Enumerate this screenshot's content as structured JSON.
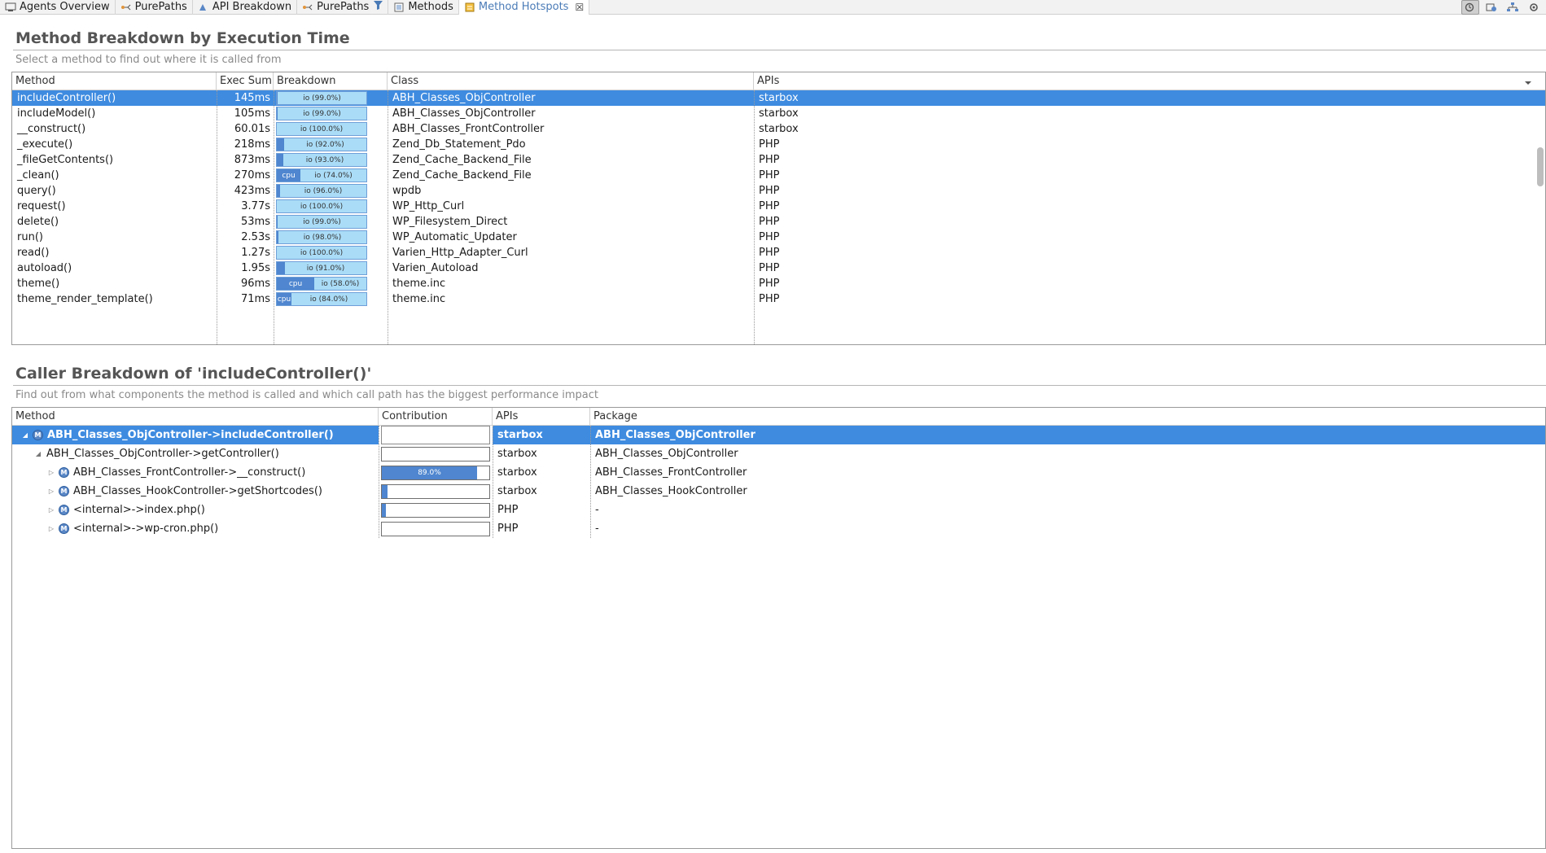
{
  "tabs": [
    {
      "label": "Agents Overview",
      "icon": "agents-icon",
      "active": false
    },
    {
      "label": "PurePaths",
      "icon": "purepaths-icon",
      "active": false
    },
    {
      "label": "API Breakdown",
      "icon": "api-breakdown-icon",
      "active": false
    },
    {
      "label": "PurePaths",
      "icon": "purepaths-filter-icon",
      "active": false
    },
    {
      "label": "Methods",
      "icon": "methods-icon",
      "active": false
    },
    {
      "label": "Method Hotspots",
      "icon": "hotspots-icon",
      "active": true,
      "closable": true
    }
  ],
  "toolbar": {
    "buttons": [
      "view-mode-icon",
      "export-icon",
      "hierarchy-icon",
      "settings-icon"
    ]
  },
  "method_breakdown": {
    "title": "Method Breakdown by Execution Time",
    "subtitle": "Select a method to find out where it is called from",
    "columns": [
      "Method",
      "Exec Sum",
      "Breakdown",
      "Class",
      "APIs"
    ],
    "rows": [
      {
        "method": "includeController()",
        "exec": "145ms",
        "cpu": 0.01,
        "io_label": "io (99.0%)",
        "class": "ABH_Classes_ObjController",
        "api": "starbox",
        "selected": true
      },
      {
        "method": "includeModel()",
        "exec": "105ms",
        "cpu": 0.01,
        "io_label": "io (99.0%)",
        "class": "ABH_Classes_ObjController",
        "api": "starbox"
      },
      {
        "method": "__construct()",
        "exec": "60.01s",
        "cpu": 0.0,
        "io_label": "io (100.0%)",
        "class": "ABH_Classes_FrontController",
        "api": "starbox"
      },
      {
        "method": "_execute()",
        "exec": "218ms",
        "cpu": 0.08,
        "io_label": "io (92.0%)",
        "class": "Zend_Db_Statement_Pdo",
        "api": "PHP"
      },
      {
        "method": "_fileGetContents()",
        "exec": "873ms",
        "cpu": 0.07,
        "io_label": "io (93.0%)",
        "class": "Zend_Cache_Backend_File",
        "api": "PHP"
      },
      {
        "method": "_clean()",
        "exec": "270ms",
        "cpu": 0.26,
        "cpu_label": "cpu",
        "io_label": "io (74.0%)",
        "class": "Zend_Cache_Backend_File",
        "api": "PHP"
      },
      {
        "method": "query()",
        "exec": "423ms",
        "cpu": 0.04,
        "io_label": "io (96.0%)",
        "class": "wpdb",
        "api": "PHP"
      },
      {
        "method": "request()",
        "exec": "3.77s",
        "cpu": 0.0,
        "io_label": "io (100.0%)",
        "class": "WP_Http_Curl",
        "api": "PHP"
      },
      {
        "method": "delete()",
        "exec": "53ms",
        "cpu": 0.01,
        "io_label": "io (99.0%)",
        "class": "WP_Filesystem_Direct",
        "api": "PHP"
      },
      {
        "method": "run()",
        "exec": "2.53s",
        "cpu": 0.02,
        "io_label": "io (98.0%)",
        "class": "WP_Automatic_Updater",
        "api": "PHP"
      },
      {
        "method": "read()",
        "exec": "1.27s",
        "cpu": 0.0,
        "io_label": "io (100.0%)",
        "class": "Varien_Http_Adapter_Curl",
        "api": "PHP"
      },
      {
        "method": "autoload()",
        "exec": "1.95s",
        "cpu": 0.09,
        "io_label": "io (91.0%)",
        "class": "Varien_Autoload",
        "api": "PHP"
      },
      {
        "method": "theme()",
        "exec": "96ms",
        "cpu": 0.42,
        "cpu_label": "cpu",
        "io_label": "io (58.0%)",
        "class": "theme.inc",
        "api": "PHP"
      },
      {
        "method": "theme_render_template()",
        "exec": "71ms",
        "cpu": 0.16,
        "cpu_label": "cpu",
        "io_label": "io (84.0%)",
        "class": "theme.inc",
        "api": "PHP"
      }
    ]
  },
  "caller_breakdown": {
    "title": "Caller Breakdown of 'includeController()'",
    "subtitle": "Find out from what components the method is called and which call path has the biggest performance impact",
    "columns": [
      "Method",
      "Contribution",
      "APIs",
      "Package"
    ],
    "rows": [
      {
        "method": "ABH_Classes_ObjController->includeController()",
        "level": 0,
        "twisty": "open",
        "has_icon": true,
        "contribution": null,
        "api": "starbox",
        "package": "ABH_Classes_ObjController",
        "selected": true
      },
      {
        "method": "ABH_Classes_ObjController->getController()",
        "level": 1,
        "twisty": "open",
        "has_icon": false,
        "contribution": null,
        "api": "starbox",
        "package": "ABH_Classes_ObjController"
      },
      {
        "method": "ABH_Classes_FrontController->__construct()",
        "level": 2,
        "twisty": "closed",
        "has_icon": true,
        "contribution": 0.89,
        "contribution_label": "89.0%",
        "api": "starbox",
        "package": "ABH_Classes_FrontController"
      },
      {
        "method": "ABH_Classes_HookController->getShortcodes()",
        "level": 2,
        "twisty": "closed",
        "has_icon": true,
        "contribution": 0.05,
        "api": "starbox",
        "package": "ABH_Classes_HookController"
      },
      {
        "method": "<internal>->index.php()",
        "level": 2,
        "twisty": "closed",
        "has_icon": true,
        "contribution": 0.04,
        "api": "PHP",
        "package": "-"
      },
      {
        "method": "<internal>->wp-cron.php()",
        "level": 2,
        "twisty": "closed",
        "has_icon": true,
        "contribution": 0.0,
        "api": "PHP",
        "package": "-"
      }
    ]
  },
  "colors": {
    "selection": "#3e8be0",
    "cpu": "#4f86cf",
    "io": "#aadcf7",
    "active_tab": "#4a7bb7"
  }
}
